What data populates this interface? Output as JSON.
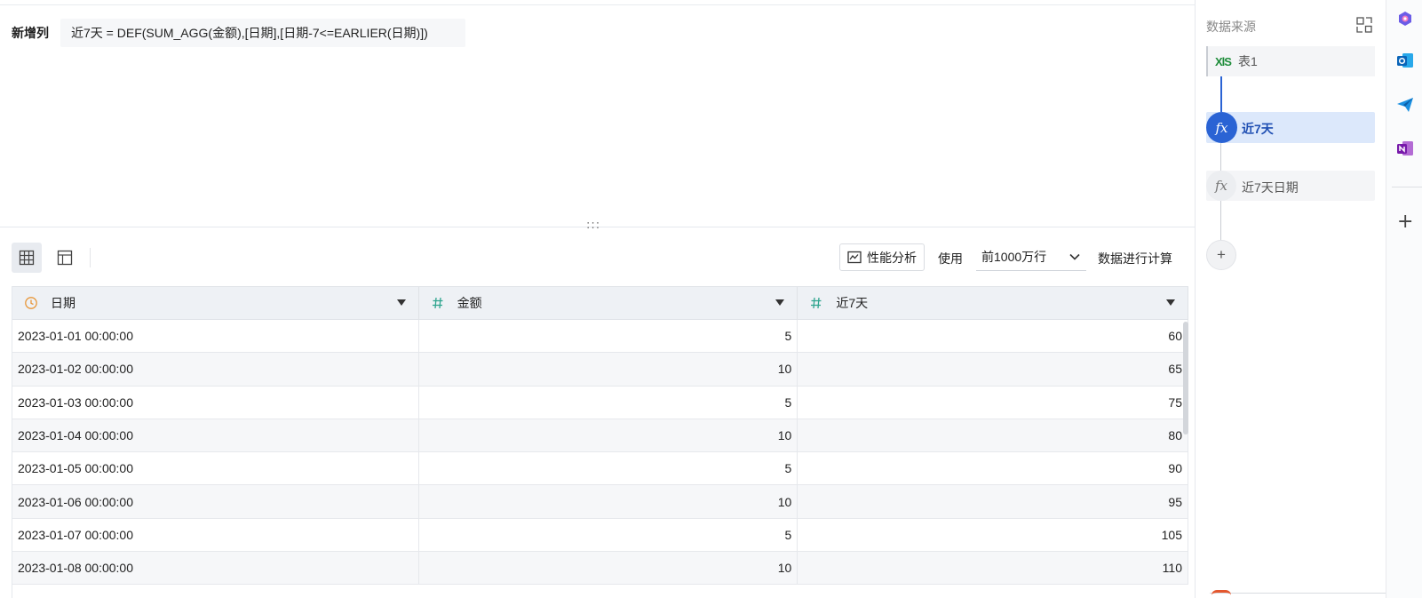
{
  "formula": {
    "label": "新增列",
    "expression": "近7天 = DEF(SUM_AGG(金额),[日期],[日期-7<=EARLIER(日期)])"
  },
  "splitter_handle": ":::",
  "toolbar": {
    "perf_label": "性能分析",
    "use_label": "使用",
    "rows_value": "前1000万行",
    "compute_label": "数据进行计算"
  },
  "table": {
    "columns": [
      {
        "label": "日期",
        "icon": "clock-icon"
      },
      {
        "label": "金额",
        "icon": "hash-icon"
      },
      {
        "label": "近7天",
        "icon": "hash-icon"
      }
    ],
    "rows": [
      [
        "2023-01-01 00:00:00",
        "5",
        "60"
      ],
      [
        "2023-01-02 00:00:00",
        "10",
        "65"
      ],
      [
        "2023-01-03 00:00:00",
        "5",
        "75"
      ],
      [
        "2023-01-04 00:00:00",
        "10",
        "80"
      ],
      [
        "2023-01-05 00:00:00",
        "5",
        "90"
      ],
      [
        "2023-01-06 00:00:00",
        "10",
        "95"
      ],
      [
        "2023-01-07 00:00:00",
        "5",
        "105"
      ],
      [
        "2023-01-08 00:00:00",
        "10",
        "110"
      ]
    ]
  },
  "side": {
    "title": "数据来源",
    "table_node": {
      "badge": "XlS",
      "label": "表1"
    },
    "steps": [
      {
        "icon": "fx",
        "label": "近7天",
        "active": true
      },
      {
        "icon": "fx",
        "label": "近7天日期",
        "active": false
      }
    ],
    "add": "+"
  },
  "appbar": {
    "add": "+"
  },
  "colors": {
    "accent": "#2a63d4",
    "header_bg": "#eef1f5",
    "xls_green": "#1e8c3a"
  }
}
